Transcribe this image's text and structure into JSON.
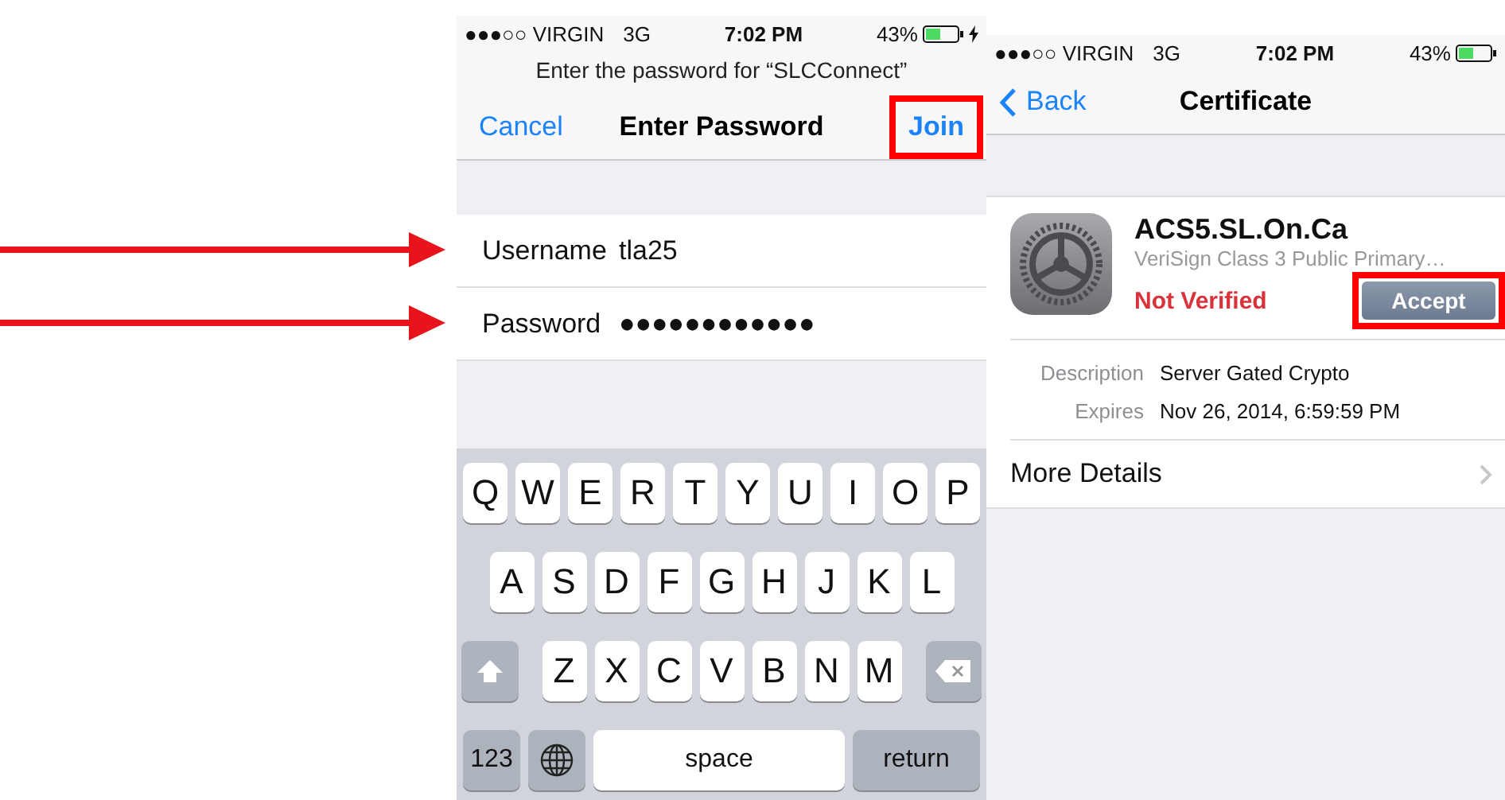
{
  "wifi_screen": {
    "status_bar": {
      "carrier": "●●●○○ VIRGIN",
      "network": "3G",
      "time": "7:02 PM",
      "battery": "43%",
      "charging": true
    },
    "prompt": "Enter the password for “SLCConnect”",
    "nav": {
      "cancel": "Cancel",
      "title": "Enter Password",
      "join": {
        "label": "Join",
        "highlighted": true
      }
    },
    "fields": [
      {
        "label": "Username",
        "value": "tla25",
        "arrow": true
      },
      {
        "label": "Password",
        "value": "●●●●●●●●●●●●",
        "arrow": true
      }
    ],
    "keyboard": {
      "rows": [
        {
          "keys": [
            {
              "kind": "letter",
              "label": "Q"
            },
            {
              "kind": "letter",
              "label": "W"
            },
            {
              "kind": "letter",
              "label": "E"
            },
            {
              "kind": "letter",
              "label": "R"
            },
            {
              "kind": "letter",
              "label": "T"
            },
            {
              "kind": "letter",
              "label": "Y"
            },
            {
              "kind": "letter",
              "label": "U"
            },
            {
              "kind": "letter",
              "label": "I"
            },
            {
              "kind": "letter",
              "label": "O"
            },
            {
              "kind": "letter",
              "label": "P"
            }
          ]
        },
        {
          "keys": [
            {
              "kind": "letter",
              "label": "A"
            },
            {
              "kind": "letter",
              "label": "S"
            },
            {
              "kind": "letter",
              "label": "D"
            },
            {
              "kind": "letter",
              "label": "F"
            },
            {
              "kind": "letter",
              "label": "G"
            },
            {
              "kind": "letter",
              "label": "H"
            },
            {
              "kind": "letter",
              "label": "J"
            },
            {
              "kind": "letter",
              "label": "K"
            },
            {
              "kind": "letter",
              "label": "L"
            }
          ]
        },
        {
          "keys": [
            {
              "kind": "shift"
            },
            {
              "kind": "letter",
              "label": "Z"
            },
            {
              "kind": "letter",
              "label": "X"
            },
            {
              "kind": "letter",
              "label": "C"
            },
            {
              "kind": "letter",
              "label": "V"
            },
            {
              "kind": "letter",
              "label": "B"
            },
            {
              "kind": "letter",
              "label": "N"
            },
            {
              "kind": "letter",
              "label": "M"
            },
            {
              "kind": "delete"
            }
          ]
        },
        {
          "keys": [
            {
              "kind": "mode",
              "label": "123"
            },
            {
              "kind": "globe"
            },
            {
              "kind": "space",
              "label": "space"
            },
            {
              "kind": "return",
              "label": "return"
            }
          ]
        }
      ]
    }
  },
  "certificate_screen": {
    "status_bar": {
      "carrier": "●●●○○ VIRGIN",
      "network": "3G",
      "time": "7:02 PM",
      "battery": "43%",
      "charging": false
    },
    "nav": {
      "back": "Back",
      "title": "Certificate"
    },
    "certificate": {
      "name": "ACS5.SL.On.Ca",
      "issuer": "VeriSign Class 3 Public Primary…",
      "status": "Not Verified",
      "accept": {
        "label": "Accept",
        "highlighted": true
      }
    },
    "details": [
      {
        "label": "Description",
        "value": "Server Gated Crypto"
      },
      {
        "label": "Expires",
        "value": "Nov 26, 2014, 6:59:59 PM"
      }
    ],
    "more": "More Details"
  }
}
